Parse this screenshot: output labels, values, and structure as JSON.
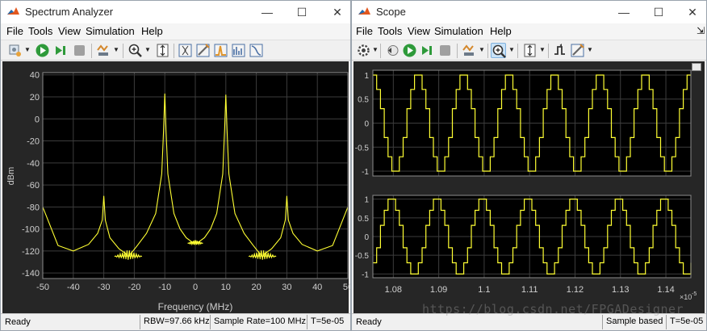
{
  "spectrum": {
    "title": "Spectrum Analyzer",
    "menu": [
      "File",
      "Tools",
      "View",
      "Simulation",
      "Help"
    ],
    "ylabel": "dBm",
    "xlabel": "Frequency (MHz)",
    "yticks": [
      "40",
      "20",
      "0",
      "-20",
      "-40",
      "-60",
      "-80",
      "-100",
      "-120",
      "-140"
    ],
    "xticks": [
      "-50",
      "-40",
      "-30",
      "-20",
      "-10",
      "0",
      "10",
      "20",
      "30",
      "40",
      "50"
    ],
    "status": {
      "ready": "Ready",
      "rbw": "RBW=97.66 kHz",
      "rate": "Sample Rate=100 MHz",
      "time": "T=5e-05"
    }
  },
  "scope": {
    "title": "Scope",
    "menu": [
      "File",
      "Tools",
      "View",
      "Simulation",
      "Help"
    ],
    "yticks1": [
      "1",
      "0.5",
      "0",
      "-0.5",
      "-1"
    ],
    "yticks2": [
      "1",
      "0.5",
      "0",
      "-0.5",
      "-1"
    ],
    "xticks": [
      "1.08",
      "1.09",
      "1.1",
      "1.11",
      "1.12",
      "1.13",
      "1.14"
    ],
    "exponent": "×10",
    "exponent_power": "-5",
    "status": {
      "ready": "Ready",
      "mode": "Sample based",
      "time": "T=5e-05"
    }
  },
  "watermark": "https://blog.csdn.net/FPGADesigner",
  "chart_data": [
    {
      "type": "line",
      "title": "",
      "xlabel": "Frequency (MHz)",
      "ylabel": "dBm",
      "xlim": [
        -50,
        50
      ],
      "ylim": [
        -145,
        42
      ],
      "grid": true,
      "series": [
        {
          "x": [
            -50,
            -45,
            -40,
            -35,
            -32,
            -30.5,
            -30,
            -29.5,
            -28,
            -25,
            -23,
            -22,
            -21,
            -19,
            -16,
            -13,
            -11,
            -10.4,
            -10,
            -9.6,
            -9,
            -7,
            -5,
            -3,
            -1,
            0,
            1,
            3,
            5,
            7,
            9,
            9.6,
            10,
            10.4,
            11,
            13,
            16,
            19,
            21,
            22,
            23,
            25,
            28,
            29.5,
            30,
            30.5,
            32,
            35,
            40,
            45,
            50
          ],
          "y": [
            -80,
            -115,
            -120,
            -114,
            -104,
            -92,
            -70,
            -92,
            -108,
            -118,
            -122,
            -125,
            -122,
            -115,
            -104,
            -86,
            -50,
            -10,
            23,
            -10,
            -50,
            -86,
            -100,
            -108,
            -112,
            -113,
            -112,
            -108,
            -100,
            -86,
            -50,
            -10,
            22,
            -10,
            -50,
            -86,
            -104,
            -115,
            -122,
            -125,
            -122,
            -118,
            -108,
            -92,
            -70,
            -92,
            -104,
            -114,
            -120,
            -115,
            -80
          ],
          "color": "#ffff33"
        }
      ]
    },
    {
      "type": "line",
      "title": "",
      "xlim": [
        1.0755,
        1.1455
      ],
      "ylim": [
        -1.1,
        1.1
      ],
      "grid": true,
      "series": [
        {
          "period": 0.01,
          "start": 1.0755,
          "step_levels": [
            1,
            0.7,
            0.3,
            -0.3,
            -0.7,
            -1,
            -1,
            -0.7,
            -0.3,
            0.3,
            0.7,
            1
          ],
          "color": "#ffff33"
        }
      ]
    },
    {
      "type": "line",
      "title": "",
      "xlim": [
        1.0755,
        1.1455
      ],
      "ylim": [
        -1.1,
        1.1
      ],
      "grid": true,
      "series": [
        {
          "period": 0.01,
          "start": 1.0755,
          "step_levels": [
            -0.7,
            -0.3,
            0.3,
            0.7,
            1,
            1,
            0.7,
            0.3,
            -0.3,
            -0.7,
            -1,
            -1
          ],
          "color": "#ffff33"
        }
      ]
    }
  ]
}
